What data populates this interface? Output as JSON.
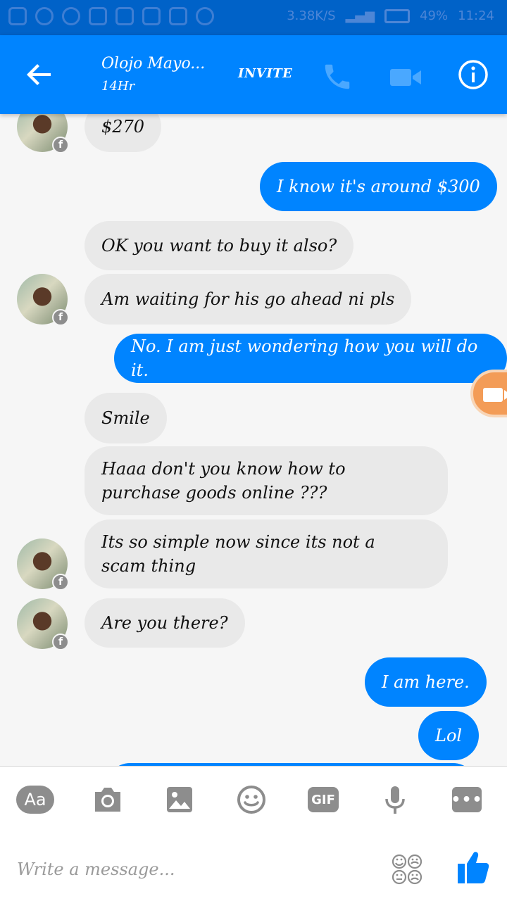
{
  "status_bar": {
    "data_rate": "3.38K/S",
    "battery": "49%",
    "time": "11:24"
  },
  "header": {
    "contact_name": "Olojo Mayo...",
    "contact_status": "14Hr",
    "invite_label": "INVITE",
    "icons": [
      "back-arrow-icon",
      "phone-icon",
      "video-camera-icon",
      "info-icon"
    ],
    "color": "#0084ff"
  },
  "messages": [
    {
      "dir": "in",
      "text": "$270"
    },
    {
      "dir": "out",
      "text": "I know it's around $300"
    },
    {
      "dir": "in",
      "text": "OK you want to buy it also?"
    },
    {
      "dir": "in",
      "text": "Am waiting for his go ahead ni pls"
    },
    {
      "dir": "out",
      "text": "No. I am just wondering how you will do it."
    },
    {
      "dir": "in",
      "text": "Smile"
    },
    {
      "dir": "in",
      "text": "Haaa don't you know how to purchase goods online ???"
    },
    {
      "dir": "in",
      "text": "Its so simple now since its not a scam thing"
    },
    {
      "dir": "in",
      "text": "Are you there?"
    },
    {
      "dir": "out",
      "text": "I am here."
    },
    {
      "dir": "out",
      "text": "Lol"
    }
  ],
  "composer": {
    "aa_label": "Aa",
    "gif_label": "GIF",
    "more_label": "•••",
    "placeholder": "Write a message...",
    "icons": [
      "aa-icon",
      "camera-icon",
      "image-icon",
      "emoji-icon",
      "gif-icon",
      "microphone-icon",
      "more-icon",
      "stickers-icon",
      "thumbs-up-icon"
    ]
  },
  "colors": {
    "outgoing_bubble": "#0084ff",
    "incoming_bubble": "#e9e9e9",
    "icon_gray": "#8d8d8d"
  }
}
